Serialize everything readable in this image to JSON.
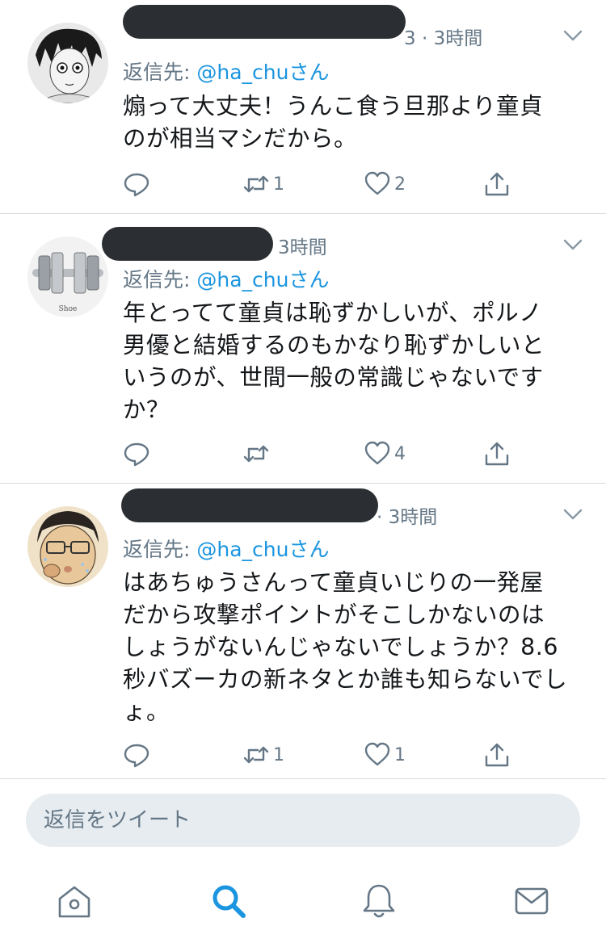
{
  "colors": {
    "accent": "#1b95e0",
    "muted": "#657786",
    "text": "#14171a",
    "divider": "#d8dde2",
    "redaction": "#2b2f33"
  },
  "tweets": [
    {
      "time": "3時間",
      "time_prefix": "3 · ",
      "reply_prefix": "返信先: ",
      "reply_handle": "@ha_chuさん",
      "lines": [
        "煽って大丈夫！うんこ食う旦那より童貞",
        "のが相当マシだから。"
      ],
      "reply_count": "",
      "retweet_count": "1",
      "like_count": "2",
      "icons": [
        "reply-icon",
        "retweet-icon",
        "like-icon",
        "share-icon"
      ]
    },
    {
      "time": "3時間",
      "time_prefix": "",
      "reply_prefix": "返信先: ",
      "reply_handle": "@ha_chuさん",
      "lines": [
        "年とってて童貞は恥ずかしいが、ポルノ",
        "男優と結婚するのもかなり恥ずかしいと",
        "いうのが、世間一般の常識じゃないです",
        "か？"
      ],
      "reply_count": "",
      "retweet_count": "",
      "like_count": "4",
      "icons": [
        "reply-icon",
        "retweet-icon",
        "like-icon",
        "share-icon"
      ]
    },
    {
      "time": "3時間",
      "time_prefix": "· ",
      "reply_prefix": "返信先: ",
      "reply_handle": "@ha_chuさん",
      "lines": [
        "はあちゅうさんって童貞いじりの一発屋",
        "だから攻撃ポイントがそこしかないのは",
        "しょうがないんじゃないでしょうか？8.6",
        "秒バズーカの新ネタとか誰も知らないでし",
        "ょ。"
      ],
      "reply_count": "",
      "retweet_count": "1",
      "like_count": "1",
      "icons": [
        "reply-icon",
        "retweet-icon",
        "like-icon",
        "share-icon"
      ]
    }
  ],
  "compose": {
    "placeholder": "返信をツイート"
  },
  "tabbar": {
    "items": [
      "home-icon",
      "search-icon",
      "notifications-icon",
      "messages-icon"
    ],
    "active": "search-icon"
  }
}
